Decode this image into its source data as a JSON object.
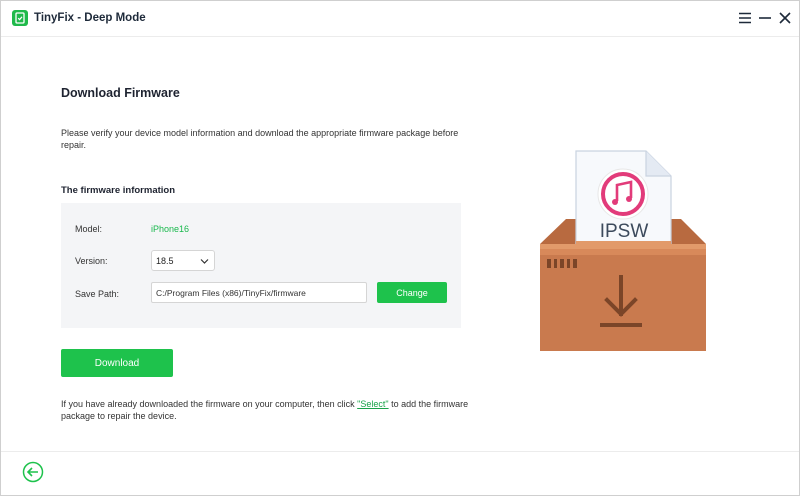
{
  "window": {
    "title": "TinyFix - Deep Mode"
  },
  "page": {
    "title": "Download Firmware",
    "description": "Please verify your device model information and download the appropriate firmware package before repair."
  },
  "firmware": {
    "section_title": "The firmware information",
    "model_label": "Model:",
    "model_value": "iPhone16",
    "version_label": "Version:",
    "version_value": "18.5",
    "path_label": "Save Path:",
    "path_value": "C:/Program Files (x86)/TinyFix/firmware",
    "change_label": "Change"
  },
  "actions": {
    "download_label": "Download"
  },
  "hint": {
    "before": "If you have already downloaded the firmware on your computer, then click ",
    "link": "\"Select\"",
    "after": " to add the firmware package to repair the device."
  },
  "illustration": {
    "file_label": "IPSW"
  },
  "colors": {
    "accent": "#1ec24c",
    "box": "#c97a4e",
    "box_lid": "#e29a6a"
  },
  "icons": {
    "app": "phone-repair-icon",
    "menu": "hamburger-menu-icon",
    "minimize": "minimize-icon",
    "close": "close-icon",
    "back": "back-arrow-icon"
  }
}
